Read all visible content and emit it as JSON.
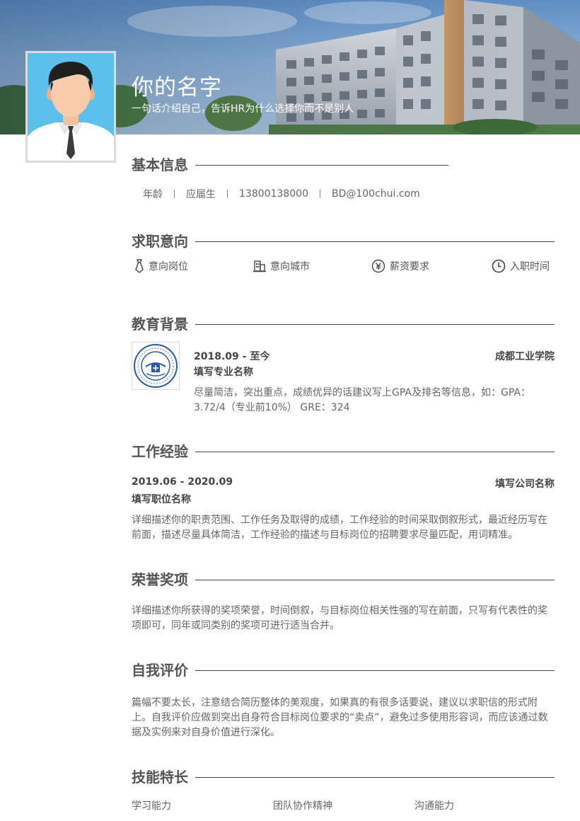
{
  "header": {
    "name": "你的名字",
    "tagline": "一句话介绍自己，告诉HR为什么选择你而不是别人"
  },
  "basic_info": {
    "title": "基本信息",
    "age": "年龄",
    "status": "应届生",
    "phone": "13800138000",
    "email": "BD@100chui.com"
  },
  "job_intent": {
    "title": "求职意向",
    "position": "意向岗位",
    "city": "意向城市",
    "salary": "薪资要求",
    "start_time": "入职时间"
  },
  "education": {
    "title": "教育背景",
    "period": "2018.09 - 至今",
    "school": "成都工业学院",
    "major": "填写专业名称",
    "description": "尽量简洁，突出重点，成绩优异的话建议写上GPA及排名等信息，如：GPA：3.72/4（专业前10%） GRE：324"
  },
  "work": {
    "title": "工作经验",
    "period": "2019.06 - 2020.09",
    "company": "填写公司名称",
    "position": "填写职位名称",
    "description": "详细描述你的职责范围、工作任务及取得的成绩，工作经验的时间采取倒叙形式，最近经历写在前面，描述尽量具体简洁，工作经验的描述与目标岗位的招聘要求尽量匹配，用词精准。"
  },
  "honors": {
    "title": "荣誉奖项",
    "description": "详细描述你所获得的奖项荣誉，时间倒叙，与目标岗位相关性强的写在前面，只写有代表性的奖项即可，同年或同类别的奖项可进行适当合并。"
  },
  "self_eval": {
    "title": "自我评价",
    "description": "篇幅不要太长，注意结合简历整体的美观度，如果真的有很多话要说，建议以求职信的形式附上。自我评价应做到突出自身符合目标岗位要求的“卖点”，避免过多使用形容词，而应该通过数据及实例来对自身价值进行深化。"
  },
  "skills": {
    "title": "技能特长",
    "items": [
      "学习能力",
      "团队协作精神",
      "沟通能力"
    ]
  },
  "colors": {
    "avatar_bg": "#5bc0eb",
    "heading": "#555555",
    "body_text": "#666666"
  },
  "icons": {
    "position": "tie-icon",
    "city": "building-icon",
    "salary": "yuan-icon",
    "start_time": "clock-icon"
  }
}
